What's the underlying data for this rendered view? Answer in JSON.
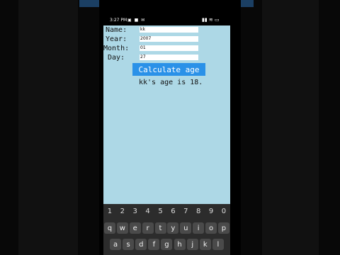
{
  "statusbar": {
    "time": "3:27 PM",
    "left_icons": "▣ ■ ✉",
    "right_icons": "▮▮ ≋ ▭"
  },
  "form": {
    "name_label": "Name:",
    "year_label": "Year:",
    "month_label": "Month:",
    "day_label": "Day:",
    "name_value": "kk",
    "year_value": "2007",
    "month_value": "01",
    "day_value": "27"
  },
  "button": {
    "label": "Calculate age"
  },
  "result": {
    "text": "kk's age is 18."
  },
  "keyboard": {
    "number_row": [
      "1",
      "2",
      "3",
      "4",
      "5",
      "6",
      "7",
      "8",
      "9",
      "0"
    ],
    "row1": [
      "q",
      "w",
      "e",
      "r",
      "t",
      "y",
      "u",
      "i",
      "o",
      "p"
    ],
    "row2": [
      "a",
      "s",
      "d",
      "f",
      "g",
      "h",
      "j",
      "k",
      "l"
    ]
  }
}
